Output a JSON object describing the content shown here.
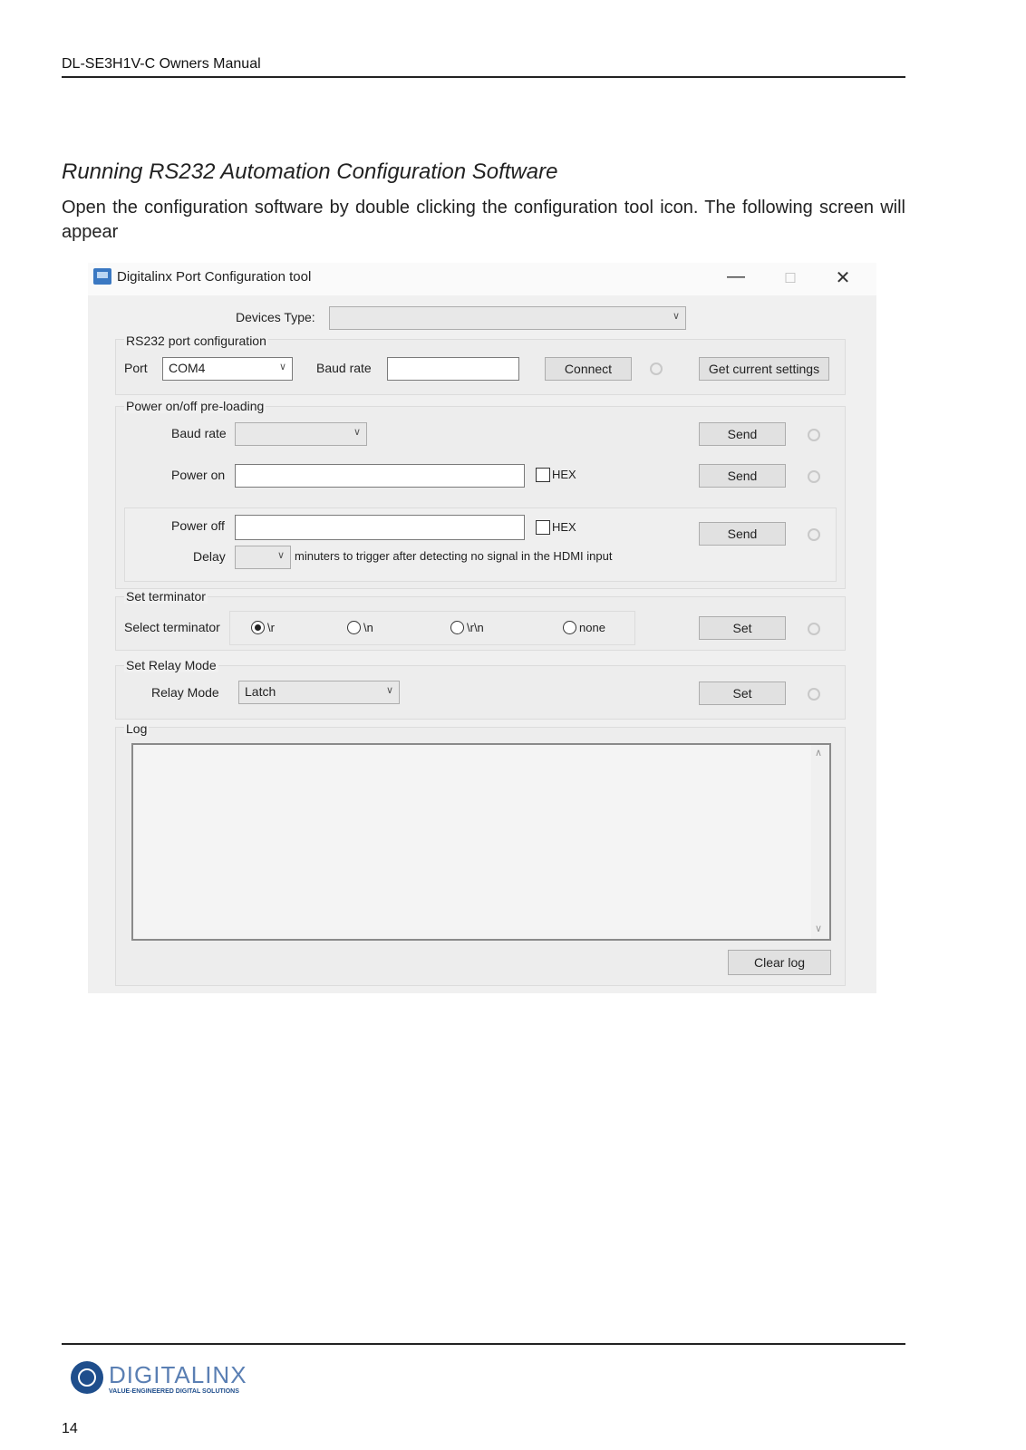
{
  "page": {
    "header": "DL-SE3H1V-C Owners Manual",
    "section_title": "Running RS232 Automation Configuration Software",
    "intro": "Open the configuration software by double clicking the configuration tool icon. The following screen will appear",
    "page_number": "14"
  },
  "logo": {
    "name": "DIGITALINX",
    "tagline": "VALUE-ENGINEERED DIGITAL SOLUTIONS"
  },
  "app": {
    "title": "Digitalinx Port Configuration tool",
    "controls": {
      "minimize": "—",
      "maximize": "☐",
      "close": "✕"
    },
    "devices_type_label": "Devices Type:",
    "devices_type_value": "",
    "rs232": {
      "group_label": "RS232 port configuration",
      "port_label": "Port",
      "port_value": "COM4",
      "baud_label": "Baud rate",
      "baud_value": "",
      "connect": "Connect",
      "get_settings": "Get current settings"
    },
    "power": {
      "group_label": "Power on/off pre-loading",
      "baud_label": "Baud rate",
      "power_on_label": "Power on",
      "power_off_label": "Power off",
      "hex_label": "HEX",
      "delay_label": "Delay",
      "delay_text": "minuters to trigger after detecting no signal in the HDMI input",
      "send": "Send"
    },
    "terminator": {
      "group_label": "Set terminator",
      "select_label": "Select terminator",
      "options": [
        "\\r",
        "\\n",
        "\\r\\n",
        "none"
      ],
      "selected": "\\r",
      "set": "Set"
    },
    "relay": {
      "group_label": "Set Relay Mode",
      "mode_label": "Relay Mode",
      "mode_value": "Latch",
      "set": "Set"
    },
    "log": {
      "group_label": "Log",
      "clear": "Clear log"
    }
  }
}
